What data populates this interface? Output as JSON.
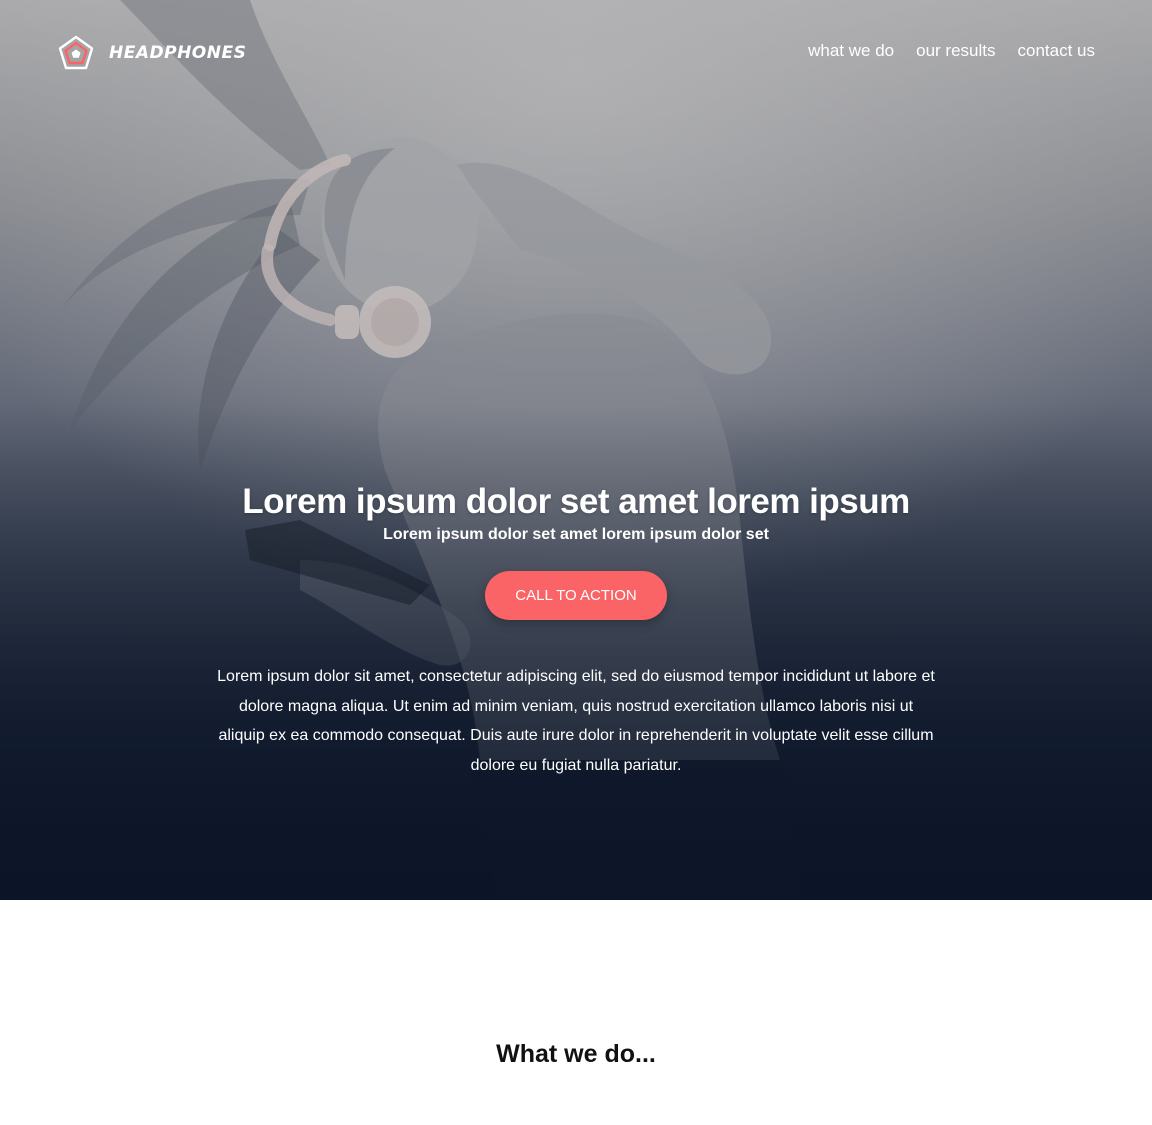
{
  "brand": {
    "name": "HEADPHONES",
    "logo_icon": "pentagon-logo-icon",
    "accent_color": "#fa6466"
  },
  "nav": {
    "links": [
      {
        "label": "what we do"
      },
      {
        "label": "our results"
      },
      {
        "label": "contact us"
      }
    ]
  },
  "hero": {
    "title": "Lorem ipsum dolor set amet lorem ipsum",
    "subtitle": "Lorem ipsum dolor set amet lorem ipsum dolor set",
    "cta_label": "CALL TO ACTION",
    "cta_color": "#fa6466",
    "body": "Lorem ipsum dolor sit amet, consectetur adipiscing elit, sed do eiusmod tempor incididunt ut labore et dolore magna aliqua. Ut enim ad minim veniam, quis nostrud exercitation ullamco laboris nisi ut aliquip ex ea commodo consequat. Duis aute irure dolor in reprehenderit in voluptate velit esse cillum dolore eu fugiat nulla pariatur.",
    "overlay_color": "#0b1527"
  },
  "section": {
    "title": "What we do..."
  }
}
